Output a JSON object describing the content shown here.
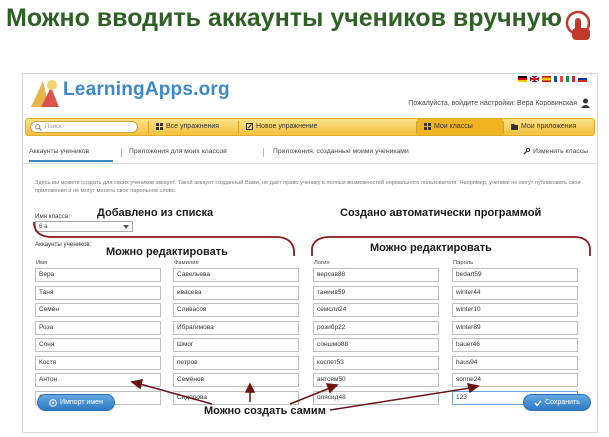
{
  "slide": {
    "title": "Можно вводить аккаунты учеников вручную"
  },
  "app": {
    "logo_text": "LearningApps.org",
    "user_line": "Пожалуйста, войдите настройки: Вера Коровинская",
    "search_placeholder": "Поиск",
    "nav": {
      "all_apps": "Все упражнения",
      "new_app": "Новое упражнение",
      "my_classes": "Мои классы",
      "my_apps": "Мои приложения"
    },
    "tabs": {
      "student_accounts": "Аккаунты учеников",
      "apps_for_classes": "Приложения для моих классов",
      "apps_by_students": "Приложения, созданные моими учениками",
      "edit_classes": "Изменить классы"
    },
    "description": "Здесь вы можете создать для своих учеников аккаунт. Такой аккаунт созданный Вами, не даёт право ученику в полных возможностей нормального пользователя. Например, ученики не могут публиковать свои приложения и не могут менять свое парольное слово.",
    "class_label": "Имя класса:",
    "class_value": "6 а",
    "accounts_label": "Аккаунты учеников:",
    "columns": {
      "first_name": "Имя",
      "last_name": "Фамилия",
      "login": "Логин",
      "password": "Пароль"
    },
    "rows": [
      {
        "first": "Вера",
        "last": "Савельева",
        "login": "версав88",
        "password": "bedart59"
      },
      {
        "first": "Таня",
        "last": "ивасева",
        "login": "таниив59",
        "password": "winter44"
      },
      {
        "first": "Семён",
        "last": "Сливасов",
        "login": "семсли24",
        "password": "winter10"
      },
      {
        "first": "Роза",
        "last": "Ибрагимова",
        "login": "розибр22",
        "password": "winter89"
      },
      {
        "first": "Соня",
        "last": "Шмог",
        "login": "соншмо88",
        "password": "bauer46"
      },
      {
        "first": "Костя",
        "last": "петров",
        "login": "коспет53",
        "password": "haus94"
      },
      {
        "first": "Антон",
        "last": "Семёнов",
        "login": "антсем50",
        "password": "sonne24"
      },
      {
        "first": "Оля",
        "last": "Сидорова",
        "login": "олясид48",
        "password": "123"
      }
    ],
    "import_button": "Импорт имен",
    "save_button": "Сохранить"
  },
  "annotations": {
    "added_from_list": "Добавлено из списка",
    "auto_created": "Создано автоматически программой",
    "editable_left": "Можно редактировать",
    "editable_right": "Можно редактировать",
    "create_yourself": "Можно создать самим"
  },
  "colors": {
    "title_green": "#2e5f24",
    "bracket_red": "#8b1a1a",
    "nav_yellow": "#f3c13c",
    "button_blue": "#2f79c3"
  }
}
